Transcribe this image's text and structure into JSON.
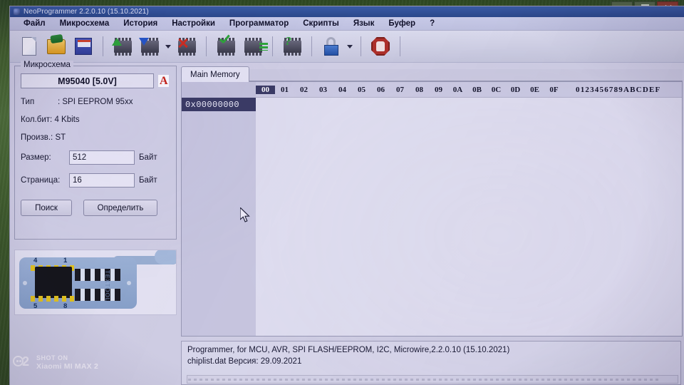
{
  "window": {
    "title": "NeoProgrammer 2.2.0.10 (15.10.2021)",
    "controls": {
      "minimize": "minimize-button",
      "maximize": "maximize-button",
      "close": "close-button"
    }
  },
  "menu": {
    "items": [
      {
        "label": "Файл"
      },
      {
        "label": "Микросхема"
      },
      {
        "label": "История"
      },
      {
        "label": "Настройки"
      },
      {
        "label": "Программатор"
      },
      {
        "label": "Скрипты"
      },
      {
        "label": "Язык"
      },
      {
        "label": "Буфер"
      },
      {
        "label": "?"
      }
    ]
  },
  "toolbar": {
    "buttons": [
      {
        "name": "new-file-icon"
      },
      {
        "name": "open-file-icon"
      },
      {
        "name": "save-file-icon"
      },
      {
        "name": "read-chip-icon"
      },
      {
        "name": "write-chip-icon"
      },
      {
        "name": "erase-chip-icon"
      },
      {
        "name": "verify-chip-icon"
      },
      {
        "name": "blank-check-icon"
      },
      {
        "name": "detect-chip-icon"
      },
      {
        "name": "unlock-icon"
      },
      {
        "name": "stop-icon"
      }
    ]
  },
  "chip_panel": {
    "group_title": "Микросхема",
    "chip_name": "M95040 [5.0V]",
    "pdf_icon_letter": "A",
    "type_label": "Тип",
    "type_value": ": SPI EEPROM 95xx",
    "bits_label": "Кол.бит:",
    "bits_value": "4 Kbits",
    "vendor_label": "Произв.:",
    "vendor_value": "ST",
    "size_label": "Размер:",
    "size_value": "512",
    "size_unit": "Байт",
    "page_label": "Страница:",
    "page_value": "16",
    "page_unit": "Байт",
    "search_button": "Поиск",
    "detect_button": "Определить",
    "socket": {
      "pin_top_left": "4",
      "pin_top_right": "1",
      "pin_bottom_left": "5",
      "pin_bottom_right": "8",
      "side_text": "TEXTOOL"
    }
  },
  "hex_editor": {
    "tabs": [
      {
        "label": "Main Memory",
        "active": true
      }
    ],
    "column_headers": [
      "00",
      "01",
      "02",
      "03",
      "04",
      "05",
      "06",
      "07",
      "08",
      "09",
      "0A",
      "0B",
      "0C",
      "0D",
      "0E",
      "0F"
    ],
    "selected_column_index": 0,
    "ascii_header": "0123456789ABCDEF",
    "rows": [
      {
        "address": "0x00000000"
      }
    ]
  },
  "status": {
    "line1": "Programmer, for MCU, AVR, SPI FLASH/EEPROM, I2C, Microwire,2.2.0.10 (15.10.2021)",
    "line2": "chiplist.dat Версия: 29.09.2021"
  },
  "watermark": {
    "line1": "SHOT ON",
    "line2": "Xiaomi MI MAX 2"
  },
  "colors": {
    "title_bar": "#33539a",
    "window_face": "#d4d3e6",
    "selection": "#3c3c66",
    "accent_green": "#2fa83c",
    "accent_red": "#cf2d22"
  }
}
